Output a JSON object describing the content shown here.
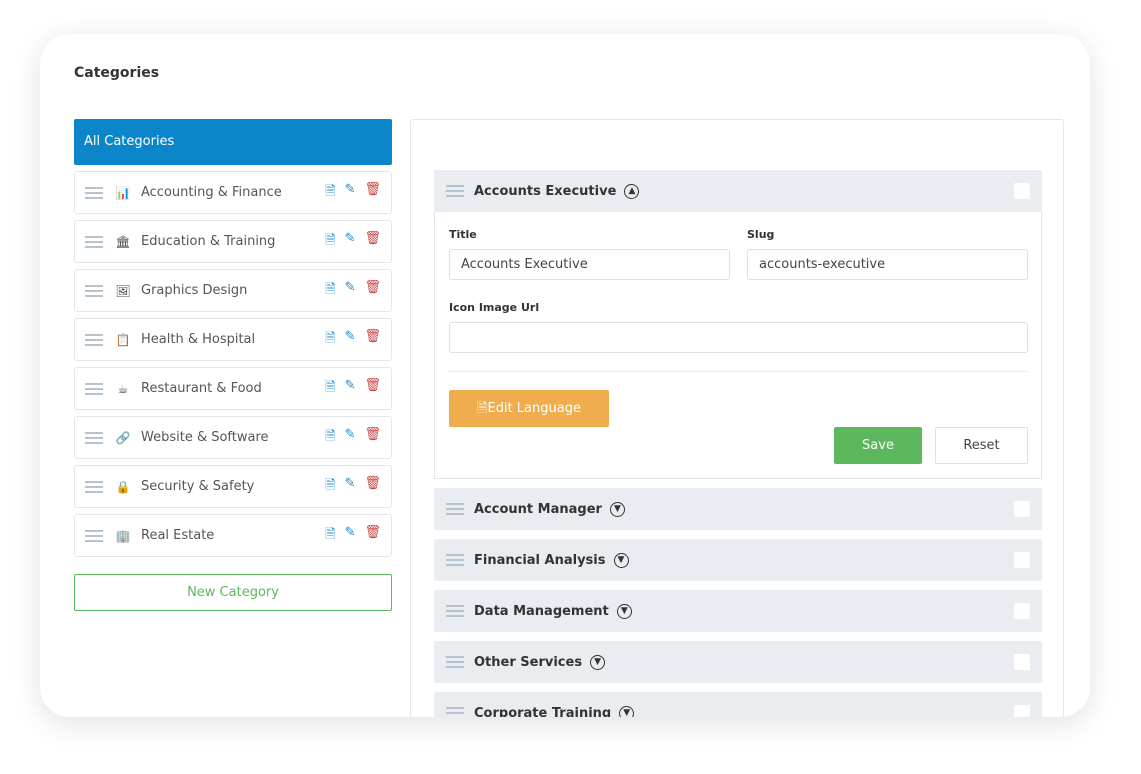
{
  "page_title": "Categories",
  "all_categories": "All Categories",
  "categories": [
    {
      "label": "Accounting & Finance",
      "icon": "chart-bar-icon",
      "glyph": "📊"
    },
    {
      "label": "Education & Training",
      "icon": "bank-icon",
      "glyph": "🏛"
    },
    {
      "label": "Graphics Design",
      "icon": "image-icon",
      "glyph": "🖼"
    },
    {
      "label": "Health & Hospital",
      "icon": "clipboard-icon",
      "glyph": "📋"
    },
    {
      "label": "Restaurant & Food",
      "icon": "coffee-icon",
      "glyph": "☕"
    },
    {
      "label": "Website & Software",
      "icon": "link-icon",
      "glyph": "🔗"
    },
    {
      "label": "Security & Safety",
      "icon": "lock-icon",
      "glyph": "🔒"
    },
    {
      "label": "Real Estate",
      "icon": "building-icon",
      "glyph": "🏢"
    }
  ],
  "new_category": "New Category",
  "expanded": {
    "title": "Accounts Executive",
    "fields": {
      "title_label": "Title",
      "title_value": "Accounts Executive",
      "slug_label": "Slug",
      "slug_value": "accounts-executive",
      "icon_label": "Icon Image Url",
      "icon_value": ""
    },
    "edit_language": "Edit Language",
    "save": "Save",
    "reset": "Reset"
  },
  "subcategories": [
    "Account Manager",
    "Financial Analysis",
    "Data Management",
    "Other Services",
    "Corporate Training"
  ],
  "colors": {
    "primary": "#0b86cb",
    "save": "#5cb85c",
    "edit_language": "#f0ad4e",
    "delete": "#c94444"
  }
}
